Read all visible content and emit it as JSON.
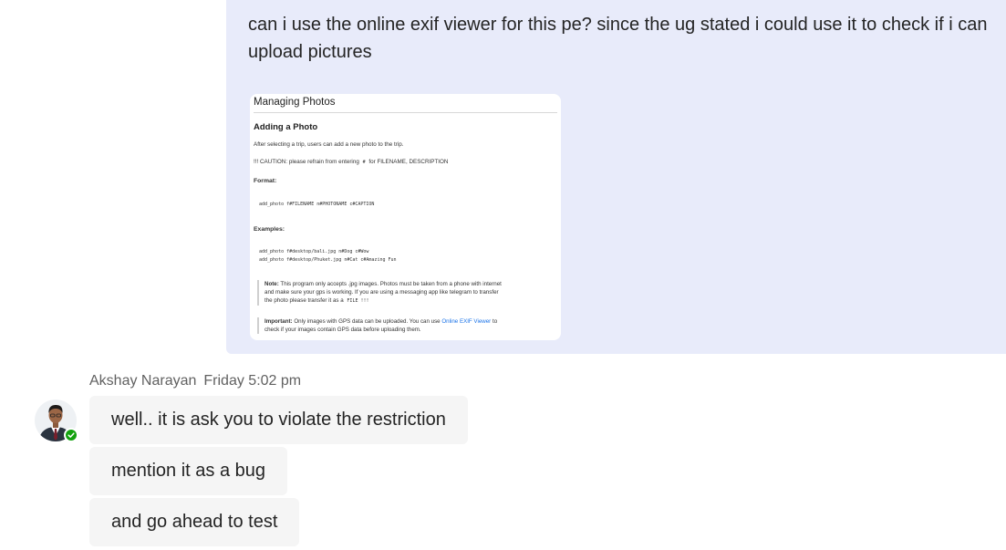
{
  "sent_message": {
    "text": "can i use the online exif viewer for this pe? since the ug stated i could use it to check if i can upload pictures",
    "attachment": {
      "title": "Managing Photos",
      "subtitle": "Adding a Photo",
      "intro": "After selecting a trip, users can add a new photo to the trip.",
      "caution_prefix": "!!! CAUTION: please refrain from entering",
      "caution_code": "#",
      "caution_suffix": "for FILENAME, DESCRIPTION",
      "format_label": "Format:",
      "format_code": "add_photo f#FILENAME n#PHOTONAME c#CAPTION",
      "examples_label": "Examples:",
      "example_1": "add_photo f#desktop/bali.jpg n#Dog c#Wow",
      "example_2": "add_photo f#desktop/Phuket.jpg n#Cat c#Amazing Fun",
      "note_label": "Note:",
      "note_text_1": "This program only accepts .jpg images. Photos must be taken from a phone with internet",
      "note_text_2": "and make sure your gps is working. If you are using a messaging app like telegram to transfer",
      "note_text_3": "the photo please transfer it as a",
      "note_code": "FILE !!!",
      "important_label": "Important:",
      "important_text_1": "Only images with GPS data can be uploaded. You can use",
      "important_link": "Online EXIF Viewer",
      "important_text_2": "to",
      "important_text_3": "check if your images contain GPS data before uploading them."
    }
  },
  "reply": {
    "sender": "Akshay Narayan",
    "time": "Friday 5:02 pm",
    "messages": [
      "well.. it is ask you to violate the restriction",
      "mention it as a bug",
      "and go ahead to test"
    ]
  },
  "colors": {
    "sent_bubble": "#e8ebfa",
    "received_bubble": "#f5f5f5",
    "presence": "#13a10e",
    "link": "#1a73e8"
  }
}
